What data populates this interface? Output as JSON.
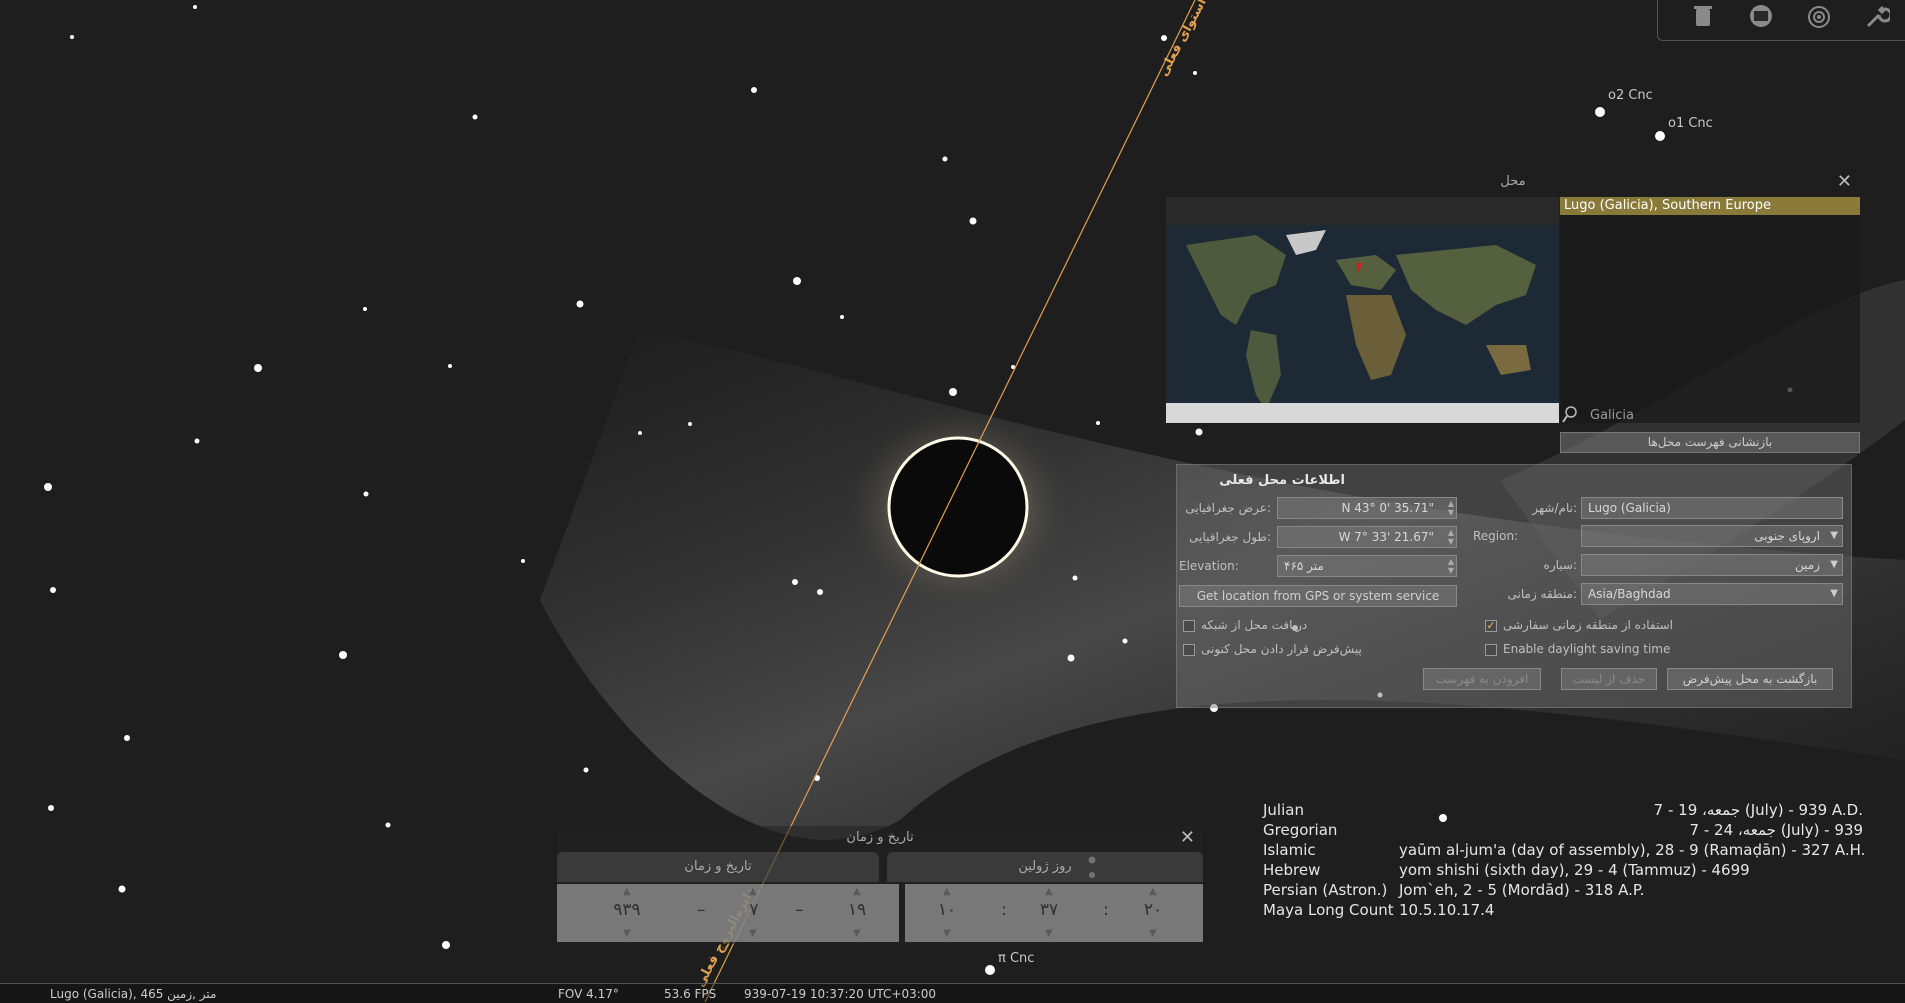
{
  "sky": {
    "stars": [
      {
        "name": "o2 Cnc"
      },
      {
        "name": "o1 Cnc"
      },
      {
        "name": "π Cnc"
      }
    ],
    "equator_label_top": "استوای فعلی",
    "equator_label_bottom": "دایره‌البروج فعلی"
  },
  "toolbar": {
    "icons": [
      "trash-icon",
      "screen-icon",
      "target-icon",
      "wrench-icon"
    ]
  },
  "location_window": {
    "title": "محل",
    "selected_location": "Lugo (Galicia), Southern Europe",
    "search_value": "Galicia",
    "reset_list_button": "بازنشانی فهرست محل‌ها",
    "current_info_heading": "اطلاعات محل فعلی",
    "latitude_label": "عرض جغرافیایی:",
    "latitude_value": "N 43° 0' 35.71\"",
    "longitude_label": "طول جغرافیایی:",
    "longitude_value": "W 7° 33' 21.67\"",
    "elevation_label": "Elevation:",
    "elevation_value": "۴۶۵ متر",
    "gps_button": "Get location from GPS or system service",
    "name_label": "نام/شهر:",
    "name_value": "Lugo (Galicia)",
    "region_label": "Region:",
    "region_value": "اروپای جنوبی",
    "planet_label": "سیاره:",
    "planet_value": "زمین",
    "timezone_label": "منطقه زمانی:",
    "timezone_value": "Asia/Baghdad",
    "check_network": "دریافت محل از شبکه",
    "check_default": "پیش‌فرض قرار دادن محل کنونی",
    "check_custom_tz": "استفاده از منطقه زمانی سفارشی",
    "check_dst": "Enable daylight saving time",
    "btn_add": "افزودن به فهرست",
    "btn_delete": "حذف از لیست",
    "btn_return_default": "بازگشت به محل پیش‌فرض"
  },
  "datetime_window": {
    "title": "تاریخ و زمان",
    "tab_date": "تاریخ و زمان",
    "tab_julian": "روز ژولین",
    "year": "۹۳۹",
    "month": "۷",
    "day": "۱۹",
    "hour": "۱۰",
    "minute": "۳۷",
    "second": "۲۰",
    "sep_dash": "–",
    "sep_colon": ":"
  },
  "calendars": [
    {
      "name": "Julian",
      "value": "جمعه، 19 - 7 (July) - 939 A.D."
    },
    {
      "name": "Gregorian",
      "value": "جمعه، 24 - 7 (July) - 939"
    },
    {
      "name": "Islamic",
      "value": "yaūm al-jum'a (day of assembly), 28 - 9 (Ramaḍān) - 327 A.H."
    },
    {
      "name": "Hebrew",
      "value": "yom shishi (sixth day), 29 - 4 (Tammuz) - 4699"
    },
    {
      "name": "Persian (Astron.)",
      "value": "Jom`eh, 2 - 5 (Mordād) - 318 A.P."
    },
    {
      "name": "Maya Long Count",
      "value": "10.5.10.17.4"
    }
  ],
  "status_bar": {
    "location": "Lugo (Galicia), 465 متر ,زمین",
    "fov": "FOV 4.17°",
    "fps": "53.6 FPS",
    "datetime": "939-07-19 10:37:20 UTC+03:00"
  },
  "colors": {
    "background": "#1c1c1c",
    "equator_line": "#e0a050",
    "selection": "#8a7a3a"
  }
}
